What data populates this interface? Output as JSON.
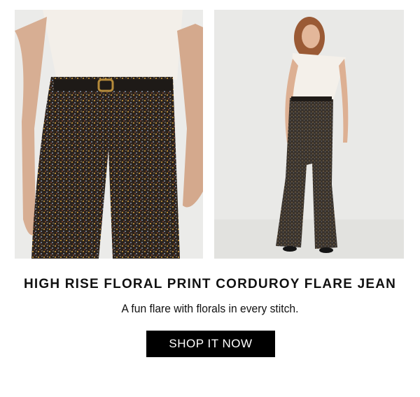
{
  "product": {
    "title": "HIGH RISE FLORAL PRINT CORDUROY FLARE JEAN",
    "tagline": "A fun flare with florals in every stitch.",
    "cta_label": "SHOP IT NOW"
  },
  "images": {
    "left": "model-closeup-floral-pants-photo",
    "right": "model-full-length-floral-flare-photo"
  },
  "colors": {
    "background": "#ffffff",
    "button_bg": "#000000",
    "button_text": "#ffffff",
    "photo_bg": "#e8e8e6",
    "pants_dark": "#2e2620",
    "top_cream": "#f2eee8"
  }
}
